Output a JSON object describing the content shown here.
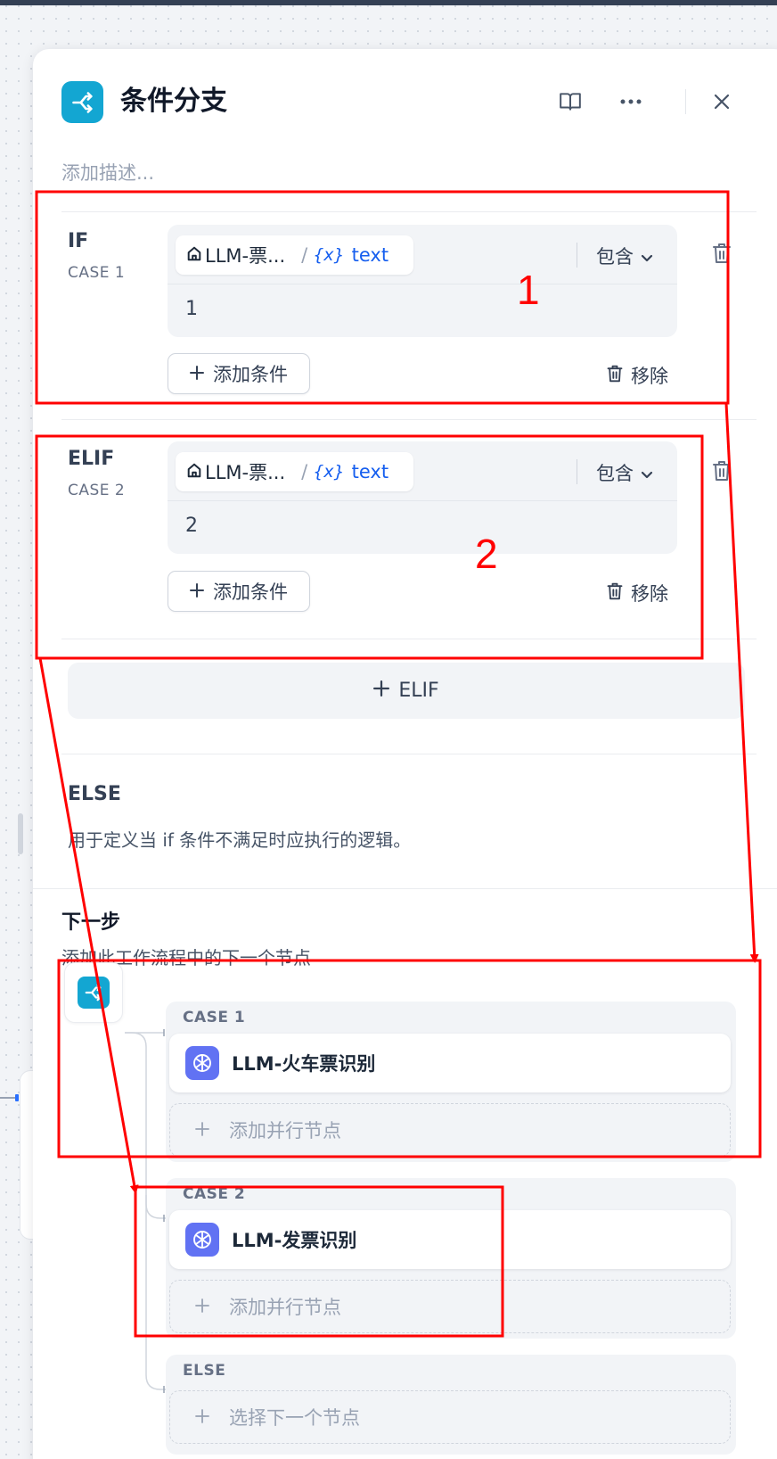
{
  "header": {
    "title": "条件分支",
    "description_placeholder": "添加描述..."
  },
  "cases": [
    {
      "label": "IF",
      "sub": "CASE 1",
      "variable": {
        "source": "LLM-票...",
        "name": "text",
        "var_prefix": "{x}"
      },
      "operator": "包含",
      "value": "1",
      "add_condition": "添加条件",
      "remove": "移除"
    },
    {
      "label": "ELIF",
      "sub": "CASE 2",
      "variable": {
        "source": "LLM-票...",
        "name": "text",
        "var_prefix": "{x}"
      },
      "operator": "包含",
      "value": "2",
      "add_condition": "添加条件",
      "remove": "移除"
    }
  ],
  "add_elif": "ELIF",
  "else_section": {
    "title": "ELSE",
    "description": "用于定义当 if 条件不满足时应执行的逻辑。"
  },
  "next_step": {
    "title": "下一步",
    "description": "添加此工作流程中的下一个节点",
    "branches": [
      {
        "label": "CASE 1",
        "node": "LLM-火车票识别",
        "add_parallel": "添加并行节点"
      },
      {
        "label": "CASE 2",
        "node": "LLM-发票识别",
        "add_parallel": "添加并行节点"
      },
      {
        "label": "ELSE",
        "select_next": "选择下一个节点"
      }
    ]
  },
  "annotations": {
    "label_1": "1",
    "label_2": "2",
    "color": "#ff0000"
  },
  "colors": {
    "accent": "#13a6d2",
    "llm": "#6172f3",
    "variable": "#155eef"
  }
}
